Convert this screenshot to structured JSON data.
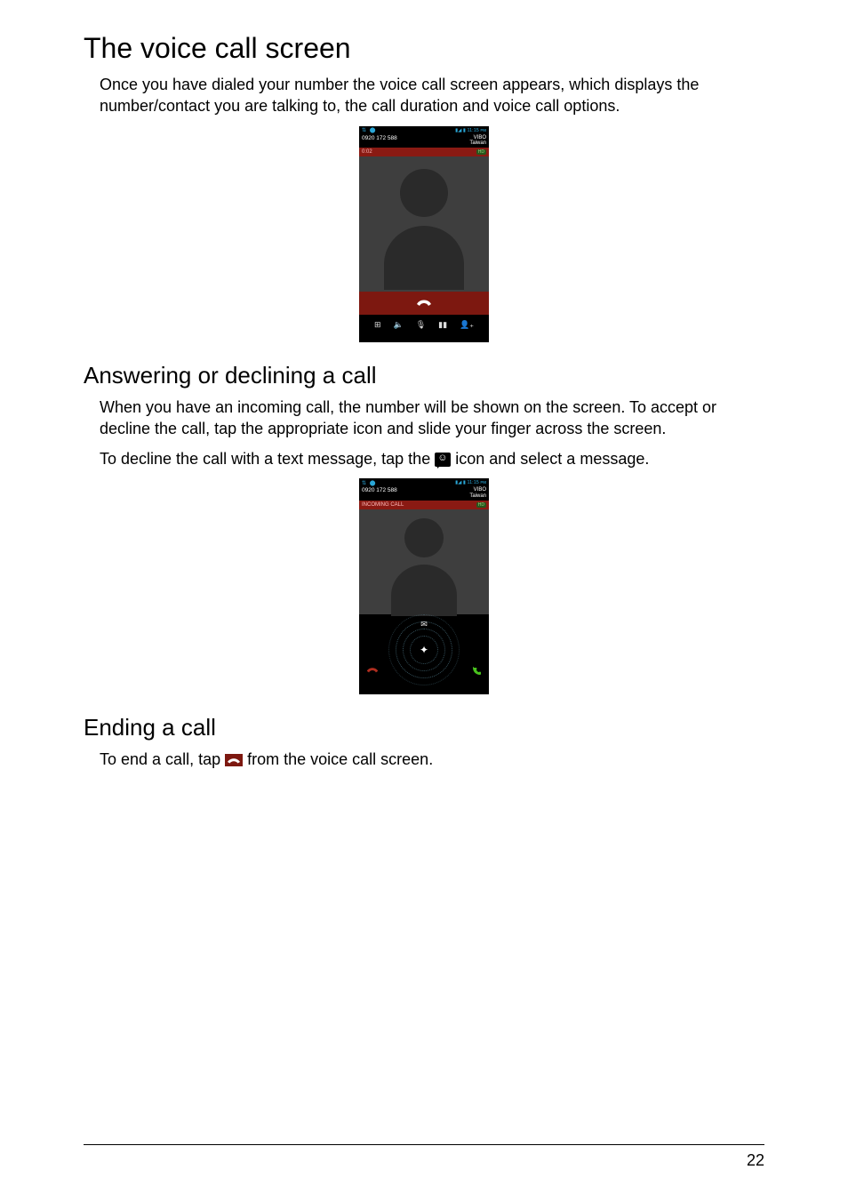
{
  "headings": {
    "h1": "The voice call screen",
    "h2a": "Answering or declining a call",
    "h2b": "Ending a call"
  },
  "paragraphs": {
    "p1": "Once you have dialed your number the voice call screen appears, which displays the number/contact you are talking to, the call duration and voice call options.",
    "p2": "When you have an incoming call, the number will be shown on the screen. To accept or decline the call, tap the appropriate icon and slide your finger across the screen.",
    "p3a": "To decline the call with a text message, tap the ",
    "p3b": " icon and select a message.",
    "p4a": "To end a call, tap ",
    "p4b": " from the voice call screen."
  },
  "phone1": {
    "status_left": "⇅ ⬤",
    "status_right": "▮◢ ▮ 11:15 ᴘᴍ",
    "number": "0920 172 588",
    "carrier_l1": "VIBO",
    "carrier_l2": "Taiwan",
    "duration": "0:02",
    "hd": "HD",
    "controls": {
      "c1": "⊞",
      "c2": "🔈",
      "c3": "🎙",
      "c4": "▮▮",
      "c5": "👤₊"
    }
  },
  "phone2": {
    "status_left": "⇅ ⬤",
    "status_right": "▮◢ ▮ 11:15 ᴘᴍ",
    "number": "0920 172 588",
    "carrier_l1": "VIBO",
    "carrier_l2": "Taiwan",
    "incoming": "INCOMING CALL",
    "hd": "HD",
    "center_glyph": "✦",
    "msg_glyph": "✉",
    "left_glyph": "end-call",
    "right_glyph": "answer-call"
  },
  "colors": {
    "end_call_red": "#af2d1f",
    "answer_green": "#49c21e"
  },
  "page_number": "22"
}
